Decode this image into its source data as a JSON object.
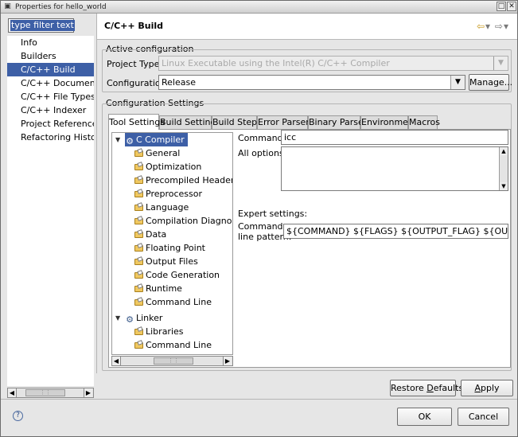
{
  "window": {
    "title": "Properties for hello_world",
    "icon": "properties-icon",
    "controls": [
      "✕"
    ]
  },
  "filter": {
    "value": "type filter text"
  },
  "nav": {
    "items": [
      {
        "label": "Info",
        "selected": false
      },
      {
        "label": "Builders",
        "selected": false
      },
      {
        "label": "C/C++ Build",
        "selected": true
      },
      {
        "label": "C/C++ Documentation",
        "selected": false
      },
      {
        "label": "C/C++ File Types",
        "selected": false
      },
      {
        "label": "C/C++ Indexer",
        "selected": false
      },
      {
        "label": "Project References",
        "selected": false
      },
      {
        "label": "Refactoring History",
        "selected": false
      }
    ]
  },
  "page": {
    "title": "C/C++ Build",
    "back_icon": "⇦",
    "dropdown_icon": "▾",
    "forward_icon": "⇨"
  },
  "active_config": {
    "group_label": "Active configuration",
    "project_type_label": "Project Type:",
    "project_type_value": "Linux Executable using the Intel(R) C/C++ Compiler",
    "configuration_label": "Configuration:",
    "configuration_value": "Release",
    "manage_button": "Manage..."
  },
  "config_settings": {
    "group_label": "Configuration Settings",
    "tabs": [
      {
        "label": "Tool Settings",
        "active": true
      },
      {
        "label": "Build Settings",
        "active": false
      },
      {
        "label": "Build Steps",
        "active": false
      },
      {
        "label": "Error Parsers",
        "active": false
      },
      {
        "label": "Binary Parser",
        "active": false
      },
      {
        "label": "Environment",
        "active": false
      },
      {
        "label": "Macros",
        "active": false
      }
    ]
  },
  "tree": {
    "compiler": {
      "label": "C Compiler",
      "children": [
        "General",
        "Optimization",
        "Precompiled Headers",
        "Preprocessor",
        "Language",
        "Compilation Diagnostics",
        "Data",
        "Floating Point",
        "Output Files",
        "Code Generation",
        "Runtime",
        "Command Line"
      ]
    },
    "linker": {
      "label": "Linker",
      "children": [
        "Libraries",
        "Command Line"
      ]
    }
  },
  "tool": {
    "command_label": "Command:",
    "command_value": "icc",
    "all_options_label": "All options:",
    "all_options_value": "",
    "expert_label": "Expert settings:",
    "pattern_label_line1": "Command",
    "pattern_label_line2": "line pattern:",
    "pattern_value": "${COMMAND} ${FLAGS} ${OUTPUT_FLAG} ${OUTPUT_PREFIX}${OUTPUT} ${INPUTS}"
  },
  "buttons": {
    "restore_defaults": "Restore Defaults",
    "apply": "Apply",
    "ok": "OK",
    "cancel": "Cancel",
    "help": "?"
  },
  "colors": {
    "selection": "#3d5fa6",
    "dialog_bg": "#e6e6e6",
    "folder": "#f0c860"
  }
}
